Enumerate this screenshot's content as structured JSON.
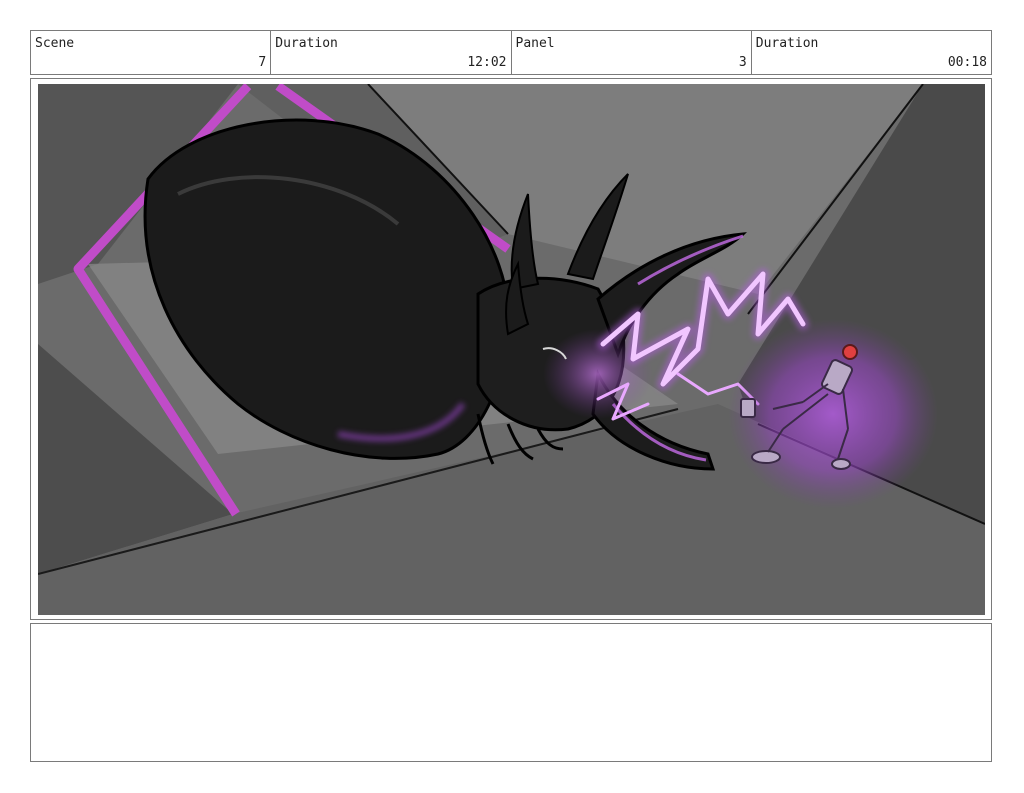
{
  "header": {
    "scene_label": "Scene",
    "scene_value": "7",
    "duration1_label": "Duration",
    "duration1_value": "12:02",
    "panel_label": "Panel",
    "panel_value": "3",
    "duration2_label": "Duration",
    "duration2_value": "00:18"
  },
  "colors": {
    "frame_magenta": "#c04cc8",
    "lightning": "#e9a8ff",
    "glow": "#a24ed0",
    "beetle": "#1c1c1c"
  }
}
